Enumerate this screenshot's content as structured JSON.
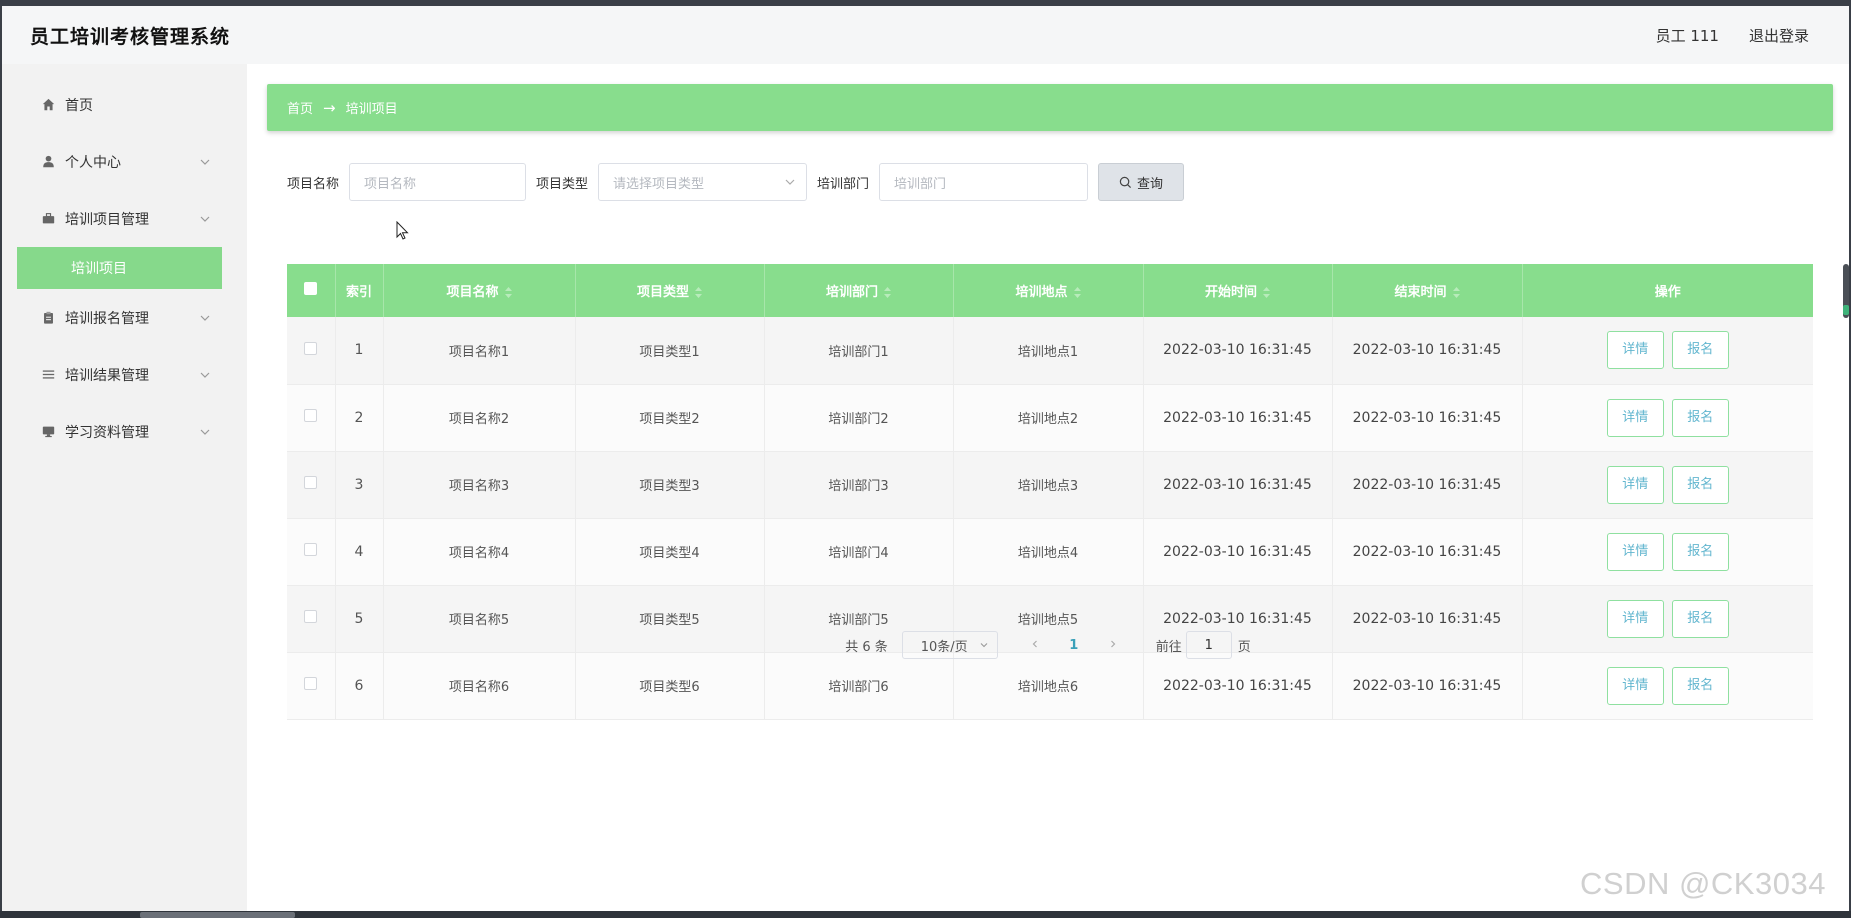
{
  "header": {
    "title": "员工培训考核管理系统",
    "user_label": "员工 111",
    "logout_label": "退出登录"
  },
  "sidebar": {
    "items": [
      {
        "label": "首页",
        "icon": "home-icon"
      },
      {
        "label": "个人中心",
        "icon": "user-icon"
      },
      {
        "label": "培训项目管理",
        "icon": "briefcase-icon"
      },
      {
        "label": "培训项目",
        "icon": "",
        "active": true
      },
      {
        "label": "培训报名管理",
        "icon": "clipboard-icon"
      },
      {
        "label": "培训结果管理",
        "icon": "list-icon"
      },
      {
        "label": "学习资料管理",
        "icon": "monitor-icon"
      }
    ]
  },
  "breadcrumb": {
    "home": "首页",
    "arrow": "→",
    "current": "培训项目"
  },
  "search": {
    "name_label": "项目名称",
    "name_placeholder": "项目名称",
    "type_label": "项目类型",
    "type_placeholder": "请选择项目类型",
    "dept_label": "培训部门",
    "dept_placeholder": "培训部门",
    "button_label": "查询"
  },
  "table": {
    "columns": [
      "索引",
      "项目名称",
      "项目类型",
      "培训部门",
      "培训地点",
      "开始时间",
      "结束时间",
      "操作"
    ],
    "rows": [
      {
        "index": "1",
        "name": "项目名称1",
        "type": "项目类型1",
        "dept": "培训部门1",
        "place": "培训地点1",
        "start": "2022-03-10 16:31:45",
        "end": "2022-03-10 16:31:45"
      },
      {
        "index": "2",
        "name": "项目名称2",
        "type": "项目类型2",
        "dept": "培训部门2",
        "place": "培训地点2",
        "start": "2022-03-10 16:31:45",
        "end": "2022-03-10 16:31:45"
      },
      {
        "index": "3",
        "name": "项目名称3",
        "type": "项目类型3",
        "dept": "培训部门3",
        "place": "培训地点3",
        "start": "2022-03-10 16:31:45",
        "end": "2022-03-10 16:31:45"
      },
      {
        "index": "4",
        "name": "项目名称4",
        "type": "项目类型4",
        "dept": "培训部门4",
        "place": "培训地点4",
        "start": "2022-03-10 16:31:45",
        "end": "2022-03-10 16:31:45"
      },
      {
        "index": "5",
        "name": "项目名称5",
        "type": "项目类型5",
        "dept": "培训部门5",
        "place": "培训地点5",
        "start": "2022-03-10 16:31:45",
        "end": "2022-03-10 16:31:45"
      },
      {
        "index": "6",
        "name": "项目名称6",
        "type": "项目类型6",
        "dept": "培训部门6",
        "place": "培训地点6",
        "start": "2022-03-10 16:31:45",
        "end": "2022-03-10 16:31:45"
      }
    ],
    "detail_label": "详情",
    "enroll_label": "报名"
  },
  "pagination": {
    "total": "共 6 条",
    "page_size": "10条/页",
    "current_page": "1",
    "goto_label": "前往",
    "goto_value": "1",
    "page_suffix": "页"
  },
  "watermark": "CSDN @CK3034",
  "colors": {
    "accent_green": "#88dd8d",
    "link_blue": "#62b6cf",
    "sidebar_bg": "#f2f2f2"
  }
}
